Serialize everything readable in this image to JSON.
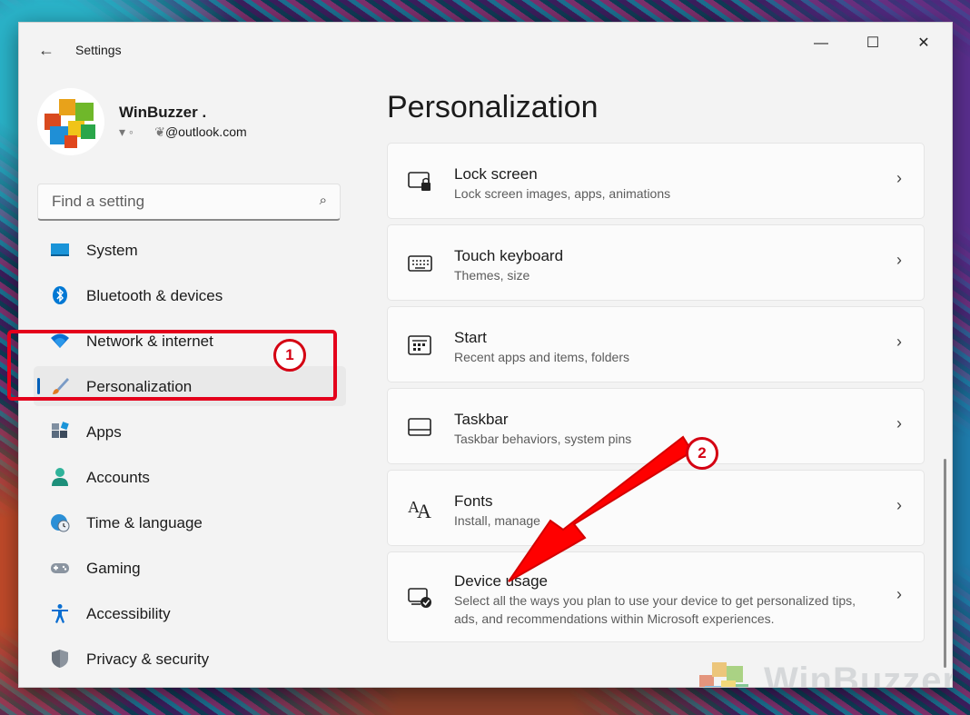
{
  "window": {
    "app_title": "Settings",
    "controls": {
      "minimize": "—",
      "maximize": "☐",
      "close": "✕"
    }
  },
  "profile": {
    "name": "WinBuzzer .",
    "email": "@outlook.com"
  },
  "search": {
    "placeholder": "Find a setting"
  },
  "nav": {
    "items": [
      {
        "label": "System",
        "icon": "system-icon"
      },
      {
        "label": "Bluetooth & devices",
        "icon": "bluetooth-icon"
      },
      {
        "label": "Network & internet",
        "icon": "wifi-icon"
      },
      {
        "label": "Personalization",
        "icon": "brush-icon",
        "active": true
      },
      {
        "label": "Apps",
        "icon": "apps-icon"
      },
      {
        "label": "Accounts",
        "icon": "person-icon"
      },
      {
        "label": "Time & language",
        "icon": "globe-clock-icon"
      },
      {
        "label": "Gaming",
        "icon": "gamepad-icon"
      },
      {
        "label": "Accessibility",
        "icon": "accessibility-icon"
      },
      {
        "label": "Privacy & security",
        "icon": "shield-icon"
      }
    ]
  },
  "page": {
    "title": "Personalization",
    "cards": [
      {
        "title": "Lock screen",
        "subtitle": "Lock screen images, apps, animations",
        "icon": "lock-screen-icon"
      },
      {
        "title": "Touch keyboard",
        "subtitle": "Themes, size",
        "icon": "keyboard-icon"
      },
      {
        "title": "Start",
        "subtitle": "Recent apps and items, folders",
        "icon": "start-icon"
      },
      {
        "title": "Taskbar",
        "subtitle": "Taskbar behaviors, system pins",
        "icon": "taskbar-icon"
      },
      {
        "title": "Fonts",
        "subtitle": "Install, manage",
        "icon": "fonts-icon"
      },
      {
        "title": "Device usage",
        "subtitle": "Select all the ways you plan to use your device to get personalized tips, ads, and recommendations within Microsoft experiences.",
        "icon": "device-usage-icon"
      }
    ],
    "chevron": "›"
  },
  "annotations": {
    "step1": "1",
    "step2": "2",
    "arrow_color": "#ff0000",
    "box_color": "#e4001b"
  },
  "watermark": {
    "text": "WinBuzzer"
  },
  "colors": {
    "accent": "#005fb8",
    "window_bg": "#f3f3f3",
    "card_bg": "#fbfbfb"
  }
}
